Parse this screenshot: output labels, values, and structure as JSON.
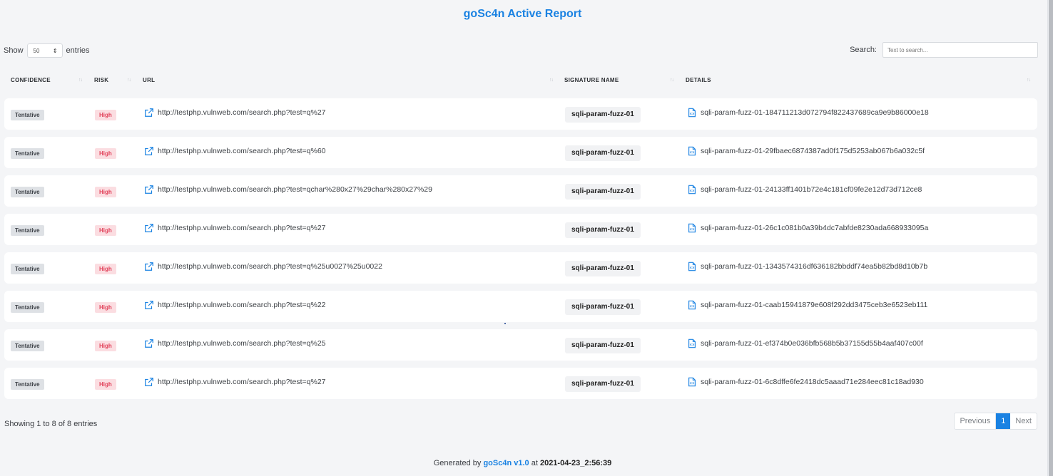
{
  "title": "goSc4n Active Report",
  "length_menu": {
    "prefix": "Show",
    "value": "50",
    "suffix": "entries"
  },
  "search": {
    "label": "Search:",
    "placeholder": "Text to search..."
  },
  "columns": [
    "CONFIDENCE",
    "RISK",
    "URL",
    "SIGNATURE NAME",
    "DETAILS"
  ],
  "rows": [
    {
      "confidence": "Tentative",
      "risk": "High",
      "url": "http://testphp.vulnweb.com/search.php?test=q%27",
      "signature": "sqli-param-fuzz-01",
      "details": "sqli-param-fuzz-01-184711213d072794f822437689ca9e9b86000e18"
    },
    {
      "confidence": "Tentative",
      "risk": "High",
      "url": "http://testphp.vulnweb.com/search.php?test=q%60",
      "signature": "sqli-param-fuzz-01",
      "details": "sqli-param-fuzz-01-29fbaec6874387ad0f175d5253ab067b6a032c5f"
    },
    {
      "confidence": "Tentative",
      "risk": "High",
      "url": "http://testphp.vulnweb.com/search.php?test=qchar%280x27%29char%280x27%29",
      "signature": "sqli-param-fuzz-01",
      "details": "sqli-param-fuzz-01-24133ff1401b72e4c181cf09fe2e12d73d712ce8"
    },
    {
      "confidence": "Tentative",
      "risk": "High",
      "url": "http://testphp.vulnweb.com/search.php?test=q%27",
      "signature": "sqli-param-fuzz-01",
      "details": "sqli-param-fuzz-01-26c1c081b0a39b4dc7abfde8230ada668933095a"
    },
    {
      "confidence": "Tentative",
      "risk": "High",
      "url": "http://testphp.vulnweb.com/search.php?test=q%25u0027%25u0022",
      "signature": "sqli-param-fuzz-01",
      "details": "sqli-param-fuzz-01-1343574316df636182bbddf74ea5b82bd8d10b7b"
    },
    {
      "confidence": "Tentative",
      "risk": "High",
      "url": "http://testphp.vulnweb.com/search.php?test=q%22",
      "signature": "sqli-param-fuzz-01",
      "details": "sqli-param-fuzz-01-caab15941879e608f292dd3475ceb3e6523eb111"
    },
    {
      "confidence": "Tentative",
      "risk": "High",
      "url": "http://testphp.vulnweb.com/search.php?test=q%25",
      "signature": "sqli-param-fuzz-01",
      "details": "sqli-param-fuzz-01-ef374b0e036bfb568b5b37155d55b4aaf407c00f"
    },
    {
      "confidence": "Tentative",
      "risk": "High",
      "url": "http://testphp.vulnweb.com/search.php?test=q%27",
      "signature": "sqli-param-fuzz-01",
      "details": "sqli-param-fuzz-01-6c8dffe6fe2418dc5aaad71e284eec81c18ad930"
    }
  ],
  "info": "Showing 1 to 8 of 8 entries",
  "pagination": {
    "previous": "Previous",
    "current": "1",
    "next": "Next"
  },
  "footer": {
    "prefix": "Generated by",
    "brand": "goSc4n v1.0",
    "at": "at",
    "timestamp": "2021-04-23_2:56:39"
  },
  "colors": {
    "accent": "#1a82e2",
    "risk_high_bg": "#fbdde1",
    "risk_high_text": "#e2445c",
    "confidence_bg": "#dee1e5"
  },
  "icons": {
    "url": "external-link-icon",
    "details": "code-file-icon",
    "sort": "sort-arrows-icon"
  }
}
